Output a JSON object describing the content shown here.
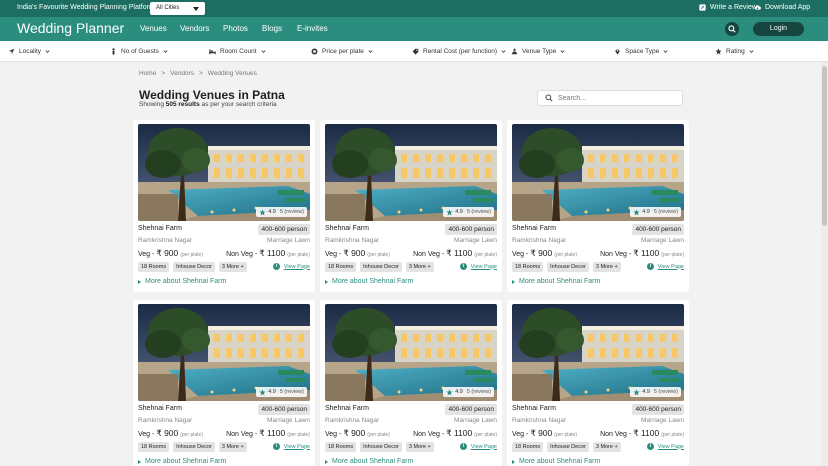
{
  "topbar": {
    "tagline": "India's Favourite Wedding Planning Platform",
    "city_select": "All Cities",
    "write_review": "Write a Review",
    "download_app": "Download App"
  },
  "navbar": {
    "brand": "Wedding Planner",
    "items": [
      "Venues",
      "Vendors",
      "Photos",
      "Blogs",
      "E-invites"
    ],
    "login": "Login"
  },
  "filters": [
    {
      "label": "Locality",
      "icon": "location-arrow-icon"
    },
    {
      "label": "No of Guests",
      "icon": "person-icon"
    },
    {
      "label": "Room Count",
      "icon": "bed-icon"
    },
    {
      "label": "Price per plate",
      "icon": "plate-icon"
    },
    {
      "label": "Rental Cost (per function)",
      "icon": "rupee-tag-icon"
    },
    {
      "label": "Venue Type",
      "icon": "venue-type-icon"
    },
    {
      "label": "Space Type",
      "icon": "map-pin-icon"
    },
    {
      "label": "Rating",
      "icon": "star-icon"
    }
  ],
  "breadcrumb": [
    "Home",
    "Vendors",
    "Wedding Venues"
  ],
  "breadcrumb_sep": ">",
  "page": {
    "title": "Wedding Venues in Patna",
    "subtitle_prefix": "Showing",
    "results": "505 results",
    "subtitle_suffix": "as per your search criteria",
    "search_placeholder": "Search..."
  },
  "venues": [
    {
      "name": "Shehnai Farm",
      "capacity": "400-600 person",
      "locality": "Ramkrishna Nagar",
      "type": "Marriage Lawn",
      "veg_label": "Veg -",
      "veg_price": "₹ 900",
      "nonveg_label": "Non Veg -",
      "nonveg_price": "₹ 1100",
      "per_plate": "(per plate)",
      "rating": "4.9",
      "reviews": "5 (review)",
      "tags": [
        "18 Rooms",
        "Inhouse Decor",
        "3 More +"
      ],
      "view_page": "View Page",
      "more": "More about Shehnai Farm"
    },
    {
      "name": "Shehnai Farm",
      "capacity": "400-600 person",
      "locality": "Ramkrishna Nagar",
      "type": "Marriage Lawn",
      "veg_label": "Veg -",
      "veg_price": "₹ 900",
      "nonveg_label": "Non Veg -",
      "nonveg_price": "₹ 1100",
      "per_plate": "(per plate)",
      "rating": "4.9",
      "reviews": "5 (review)",
      "tags": [
        "18 Rooms",
        "Inhouse Decor",
        "3 More +"
      ],
      "view_page": "View Page",
      "more": "More about Shehnai Farm"
    },
    {
      "name": "Shehnai Farm",
      "capacity": "400-600 person",
      "locality": "Ramkrishna Nagar",
      "type": "Marriage Lawn",
      "veg_label": "Veg -",
      "veg_price": "₹ 900",
      "nonveg_label": "Non Veg -",
      "nonveg_price": "₹ 1100",
      "per_plate": "(per plate)",
      "rating": "4.9",
      "reviews": "5 (review)",
      "tags": [
        "18 Rooms",
        "Inhouse Decor",
        "3 More +"
      ],
      "view_page": "View Page",
      "more": "More about Shehnai Farm"
    },
    {
      "name": "Shehnai Farm",
      "capacity": "400-600 person",
      "locality": "Ramkrishna Nagar",
      "type": "Marriage Lawn",
      "veg_label": "Veg -",
      "veg_price": "₹ 900",
      "nonveg_label": "Non Veg -",
      "nonveg_price": "₹ 1100",
      "per_plate": "(per plate)",
      "rating": "4.9",
      "reviews": "5 (review)",
      "tags": [
        "18 Rooms",
        "Inhouse Decor",
        "3 More +"
      ],
      "view_page": "View Page",
      "more": "More about Shehnai Farm"
    },
    {
      "name": "Shehnai Farm",
      "capacity": "400-600 person",
      "locality": "Ramkrishna Nagar",
      "type": "Marriage Lawn",
      "veg_label": "Veg -",
      "veg_price": "₹ 900",
      "nonveg_label": "Non Veg -",
      "nonveg_price": "₹ 1100",
      "per_plate": "(per plate)",
      "rating": "4.9",
      "reviews": "5 (review)",
      "tags": [
        "18 Rooms",
        "Inhouse Decor",
        "3 More +"
      ],
      "view_page": "View Page",
      "more": "More about Shehnai Farm"
    },
    {
      "name": "Shehnai Farm",
      "capacity": "400-600 person",
      "locality": "Ramkrishna Nagar",
      "type": "Marriage Lawn",
      "veg_label": "Veg -",
      "veg_price": "₹ 900",
      "nonveg_label": "Non Veg -",
      "nonveg_price": "₹ 1100",
      "per_plate": "(per plate)",
      "rating": "4.9",
      "reviews": "5 (review)",
      "tags": [
        "18 Rooms",
        "Inhouse Decor",
        "3 More +"
      ],
      "view_page": "View Page",
      "more": "More about Shehnai Farm"
    }
  ],
  "colors": {
    "topbar": "#1d6e62",
    "navbar": "#2b8d7e",
    "accent": "#2b8d7e",
    "dark_button": "#16463f"
  }
}
